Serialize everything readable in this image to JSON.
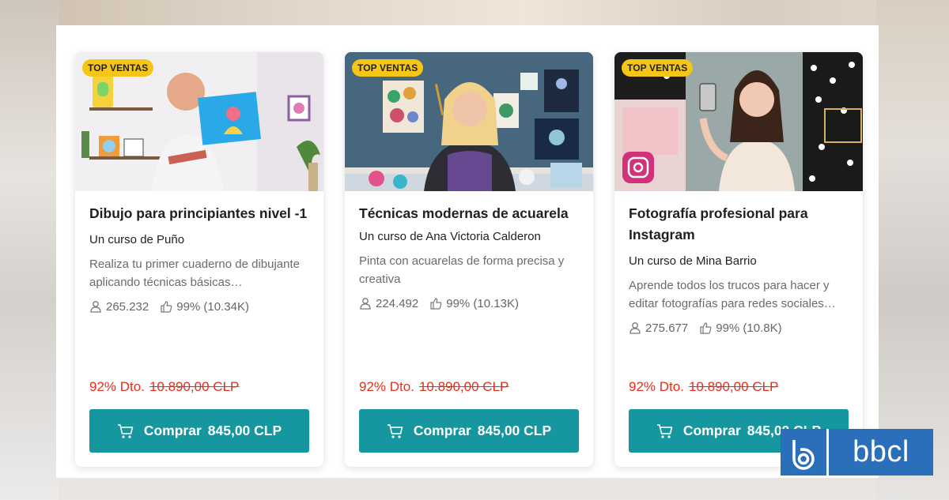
{
  "cards": [
    {
      "badge": "TOP VENTAS",
      "title": "Dibujo para principiantes nivel -1",
      "author": "Un curso de Puño",
      "description": "Realiza tu primer cuaderno de dibujante aplicando técnicas básicas…",
      "students": "265.232",
      "rating": "99% (10.34K)",
      "discount": "92% Dto.",
      "old_price": "10.890,00 CLP",
      "buy_label": "Comprar",
      "buy_price": "845,00 CLP"
    },
    {
      "badge": "TOP VENTAS",
      "title": "Técnicas modernas de acuarela",
      "author": "Un curso de Ana Victoria Calderon",
      "description": "Pinta con acuarelas de forma precisa y creativa",
      "students": "224.492",
      "rating": "99% (10.13K)",
      "discount": "92% Dto.",
      "old_price": "10.890,00 CLP",
      "buy_label": "Comprar",
      "buy_price": "845,00 CLP"
    },
    {
      "badge": "TOP VENTAS",
      "title": "Fotografía profesional para Instagram",
      "author": "Un curso de Mina Barrio",
      "description": "Aprende todos los trucos para hacer y editar fotografías para redes sociales…",
      "students": "275.677",
      "rating": "99% (10.8K)",
      "discount": "92% Dto.",
      "old_price": "10.890,00 CLP",
      "buy_label": "Comprar",
      "buy_price": "845,00 CLP"
    }
  ],
  "logo": {
    "text": "bbcl"
  },
  "colors": {
    "accent": "#16979f",
    "discount": "#e0301e",
    "badge": "#f5c518",
    "logo": "#2b6fba"
  },
  "icons": {
    "students": "user-icon",
    "rating": "thumbs-up-icon",
    "buy": "cart-icon"
  }
}
